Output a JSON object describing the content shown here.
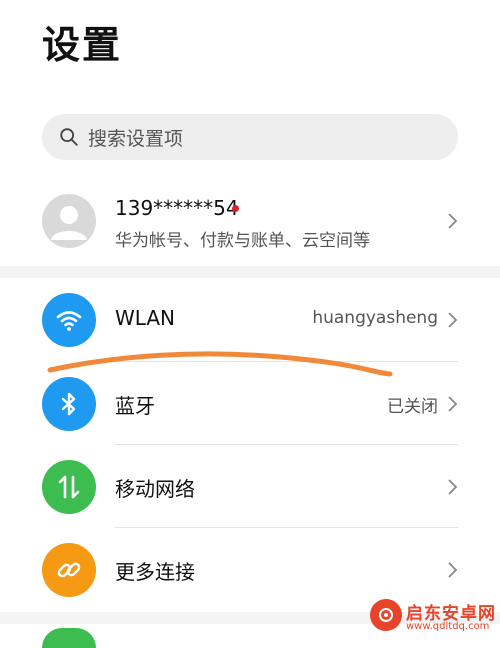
{
  "page": {
    "title": "设置"
  },
  "search": {
    "placeholder": "搜索设置项"
  },
  "account": {
    "phone": "139******54",
    "subtitle": "华为帐号、付款与账单、云空间等"
  },
  "settings": [
    {
      "label": "WLAN",
      "value": "huangyasheng",
      "icon": "wifi-icon",
      "color": "#1e9bf0"
    },
    {
      "label": "蓝牙",
      "value": "已关闭",
      "icon": "bluetooth-icon",
      "color": "#1e9bf0"
    },
    {
      "label": "移动网络",
      "value": "",
      "icon": "mobile-data-icon",
      "color": "#3dbd50"
    },
    {
      "label": "更多连接",
      "value": "",
      "icon": "link-icon",
      "color": "#f59a12"
    }
  ],
  "watermark": {
    "title": "启东安卓网",
    "url": "www.qdltdq.com"
  },
  "colors": {
    "annotation_stroke": "#f08a3a",
    "notify_dot": "#e02020"
  }
}
